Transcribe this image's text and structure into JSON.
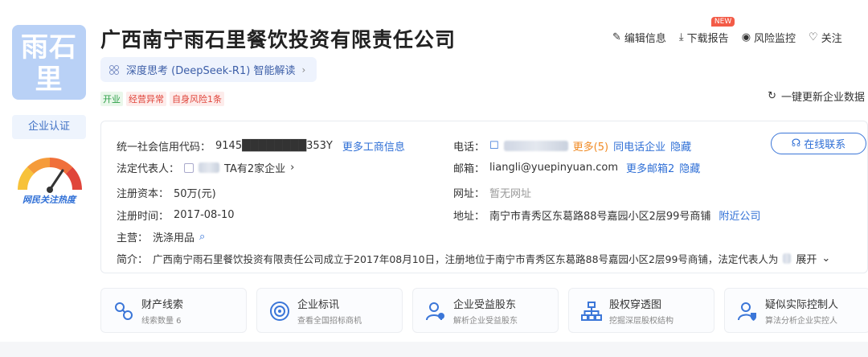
{
  "company": {
    "logo_text_line1": "雨石",
    "logo_text_line2": "里",
    "name": "广西南宁雨石里餐饮投资有限责任公司",
    "certification": "企业认证",
    "heat_label": "网民关注热度"
  },
  "ai": {
    "label": "深度思考 (DeepSeek-R1) 智能解读",
    "chevron": "›"
  },
  "tags": [
    "开业",
    "经营异常",
    "自身风险1条"
  ],
  "actions": {
    "edit": "编辑信息",
    "download": "下载报告",
    "new_badge": "NEW",
    "risk": "风险监控",
    "follow": "关注"
  },
  "refresh_label": "一键更新企业数据",
  "info": {
    "credit_code_label": "统一社会信用代码：",
    "credit_code_value": "9145████████353Y",
    "more_business": "更多工商信息",
    "legal_rep_label": "法定代表人：",
    "legal_rep_suffix": "TA有2家企业",
    "capital_label": "注册资本：",
    "capital_value": "50万(元)",
    "reg_date_label": "注册时间：",
    "reg_date_value": "2017-08-10",
    "business_label": "主营：",
    "business_value": "洗涤用品",
    "phone_label": "电话：",
    "phone_more": "更多(5)",
    "phone_same": "同电话企业",
    "phone_hide": "隐藏",
    "email_label": "邮箱：",
    "email_value": "liangli@yuepinyuan.com",
    "email_more": "更多邮箱2",
    "email_hide": "隐藏",
    "website_label": "网址：",
    "website_value": "暂无网址",
    "address_label": "地址：",
    "address_value": "南宁市青秀区东葛路88号嘉园小区2层99号商铺",
    "address_nearby": "附近公司",
    "intro_label": "简介：",
    "intro_value": "广西南宁雨石里餐饮投资有限责任公司成立于2017年08月10日，注册地位于南宁市青秀区东葛路88号嘉园小区2层99号商铺，法定代表人为",
    "intro_expand": "展开",
    "chat_button": "在线联系"
  },
  "tiles": [
    {
      "title": "财产线索",
      "sub": "线索数量 6"
    },
    {
      "title": "企业标讯",
      "sub": "查看全国招标商机"
    },
    {
      "title": "企业受益股东",
      "sub": "解析企业受益股东"
    },
    {
      "title": "股权穿透图",
      "sub": "挖掘深层股权结构"
    },
    {
      "title": "疑似实际控制人",
      "sub": "算法分析企业实控人"
    }
  ],
  "colors": {
    "accent": "#2f6fd6",
    "logo_bg": "#b9d1f6",
    "orange": "#f08a24",
    "red": "#e0453b",
    "green": "#2da048"
  }
}
